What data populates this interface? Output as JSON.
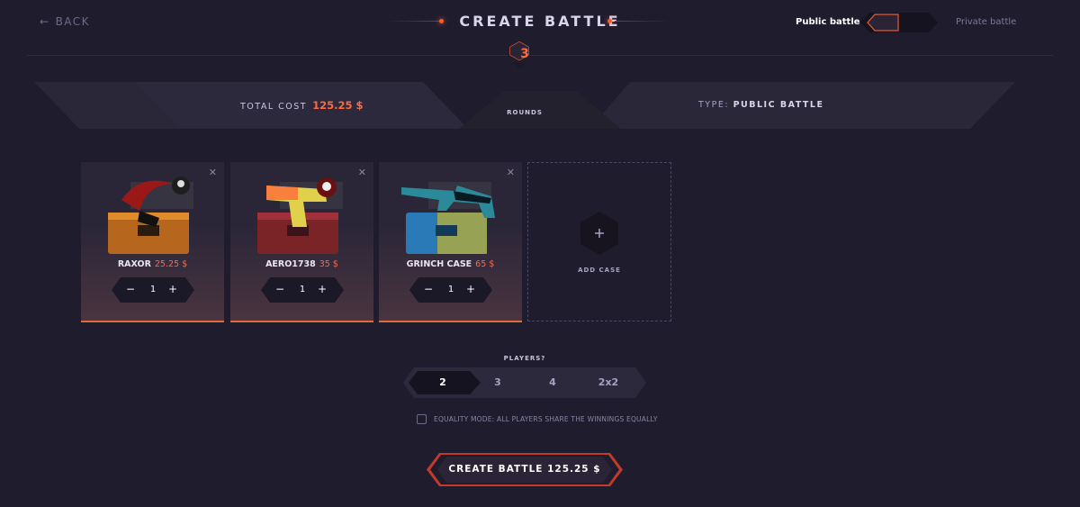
{
  "header": {
    "back_label": "BACK",
    "title": "CREATE BATTLE",
    "public_label": "Public battle",
    "private_label": "Private battle"
  },
  "rounds": {
    "value": "3",
    "label": "ROUNDS"
  },
  "info": {
    "total_label": "TOTAL COST",
    "total_value": "125.25 $",
    "type_label": "TYPE:",
    "type_value": "PUBLIC BATTLE"
  },
  "cases": [
    {
      "name": "RAXOR",
      "price": "25.25 $",
      "qty": "1",
      "icon": "knife-case-icon"
    },
    {
      "name": "AERO1738",
      "price": "35 $",
      "qty": "1",
      "icon": "pistol-case-icon"
    },
    {
      "name": "GRINCH CASE",
      "price": "65 $",
      "qty": "1",
      "icon": "rifle-case-icon"
    }
  ],
  "add_case_label": "ADD CASE",
  "players": {
    "label": "PLAYERS?",
    "options": [
      "2",
      "3",
      "4",
      "2x2"
    ],
    "selected": "2"
  },
  "equality_label": "EQUALITY MODE: ALL PLAYERS SHARE THE WINNINGS EQUALLY",
  "create_label": "CREATE BATTLE 125.25 $",
  "colors": {
    "accent": "#ff6a3d",
    "background": "#1f1c2e",
    "panel": "#2a2638"
  }
}
